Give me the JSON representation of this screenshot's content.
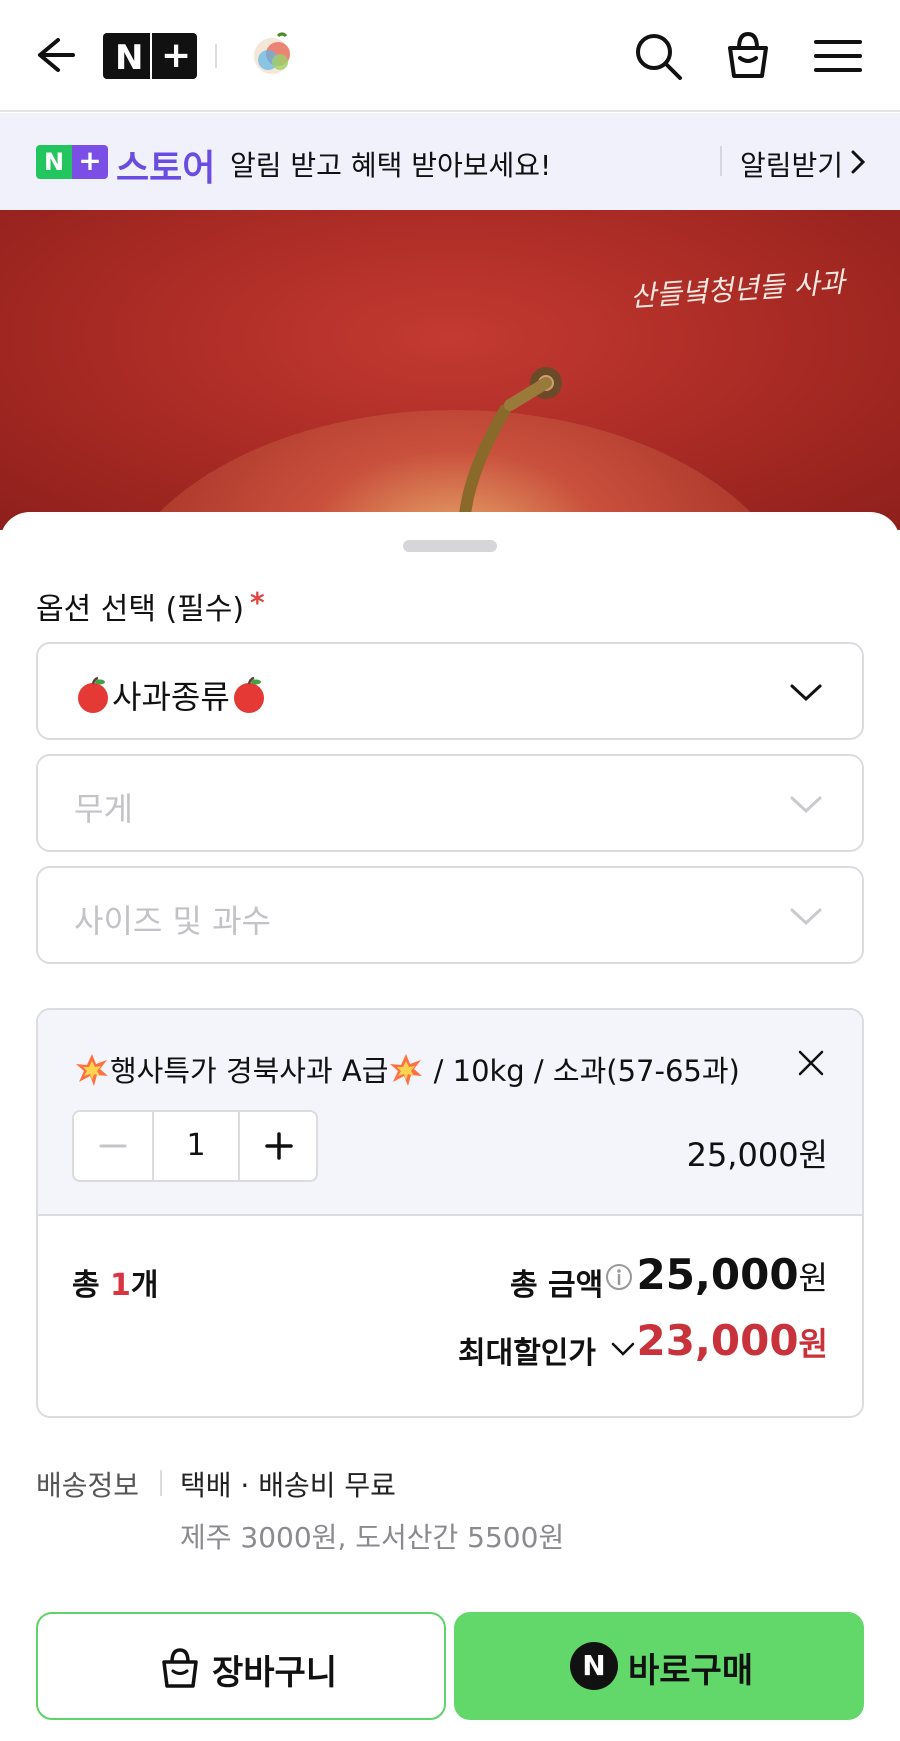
{
  "header": {
    "platform_logo": "N+",
    "store_logo_text": "산들녘청년들"
  },
  "banner": {
    "badge_text": "N+",
    "store_name": "스토어",
    "message": "알림 받고 혜택 받아보세요!",
    "action_label": "알림받기"
  },
  "hero": {
    "tagline": "산들녘청년들 사과"
  },
  "options": {
    "title": "옵션 선택 (필수)",
    "required_mark": "*",
    "selects": [
      {
        "value": "사과종류",
        "state": "selected"
      },
      {
        "placeholder": "무게",
        "state": "disabled"
      },
      {
        "placeholder": "사이즈 및 과수",
        "state": "disabled"
      }
    ]
  },
  "selected_item": {
    "name": "행사특가 경북사과 A급",
    "details": " / 10kg / 소과(57-65과)",
    "quantity": "1",
    "price": "25,000원"
  },
  "totals": {
    "count_prefix": "총 ",
    "count_value": "1",
    "count_suffix": "개",
    "total_label": "총 금액",
    "total_amount": "25,000",
    "total_unit": "원",
    "discount_label": "최대할인가",
    "discount_amount": "23,000",
    "discount_unit": "원"
  },
  "shipping": {
    "label": "배송정보",
    "value": "택배 · 배송비 무료",
    "extra": "제주 3000원, 도서산간 5500원"
  },
  "actions": {
    "cart_label": "장바구니",
    "buy_label": "바로구매",
    "buy_icon_text": "N"
  },
  "colors": {
    "accent_green": "#62d76a",
    "discount_red": "#c9313b",
    "banner_purple": "#6b4ce0"
  }
}
